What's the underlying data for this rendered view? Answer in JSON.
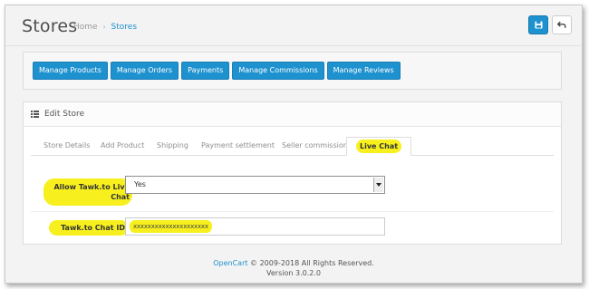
{
  "page": {
    "title": "Stores",
    "breadcrumb": [
      {
        "label": "Home"
      },
      {
        "label": "Stores"
      }
    ]
  },
  "header_buttons": {
    "save_icon": "save-icon",
    "back_icon": "undo-arrow-icon"
  },
  "toolbar": {
    "buttons": [
      {
        "label": "Manage Products"
      },
      {
        "label": "Manage Orders"
      },
      {
        "label": "Payments"
      },
      {
        "label": "Manage Commissions"
      },
      {
        "label": "Manage Reviews"
      }
    ]
  },
  "edit_panel": {
    "title": "Edit Store",
    "icon": "list-icon",
    "tabs": [
      {
        "label": "Store Details"
      },
      {
        "label": "Add Product"
      },
      {
        "label": "Shipping"
      },
      {
        "label": "Payment settlement"
      },
      {
        "label": "Seller commission"
      },
      {
        "label": "Live Chat",
        "active": true
      }
    ],
    "fields": {
      "allow_chat": {
        "label": "Allow Tawk.to Live Chat",
        "value": "Yes"
      },
      "chat_id": {
        "label": "Tawk.to Chat ID",
        "value": "xxxxxxxxxxxxxxxxxxxxx"
      }
    }
  },
  "footer": {
    "link": "OpenCart",
    "copyright": "© 2009-2018 All Rights Reserved.",
    "version": "Version 3.0.2.0"
  },
  "colors": {
    "primary": "#1e91cf",
    "highlight": "#f7f01e"
  }
}
